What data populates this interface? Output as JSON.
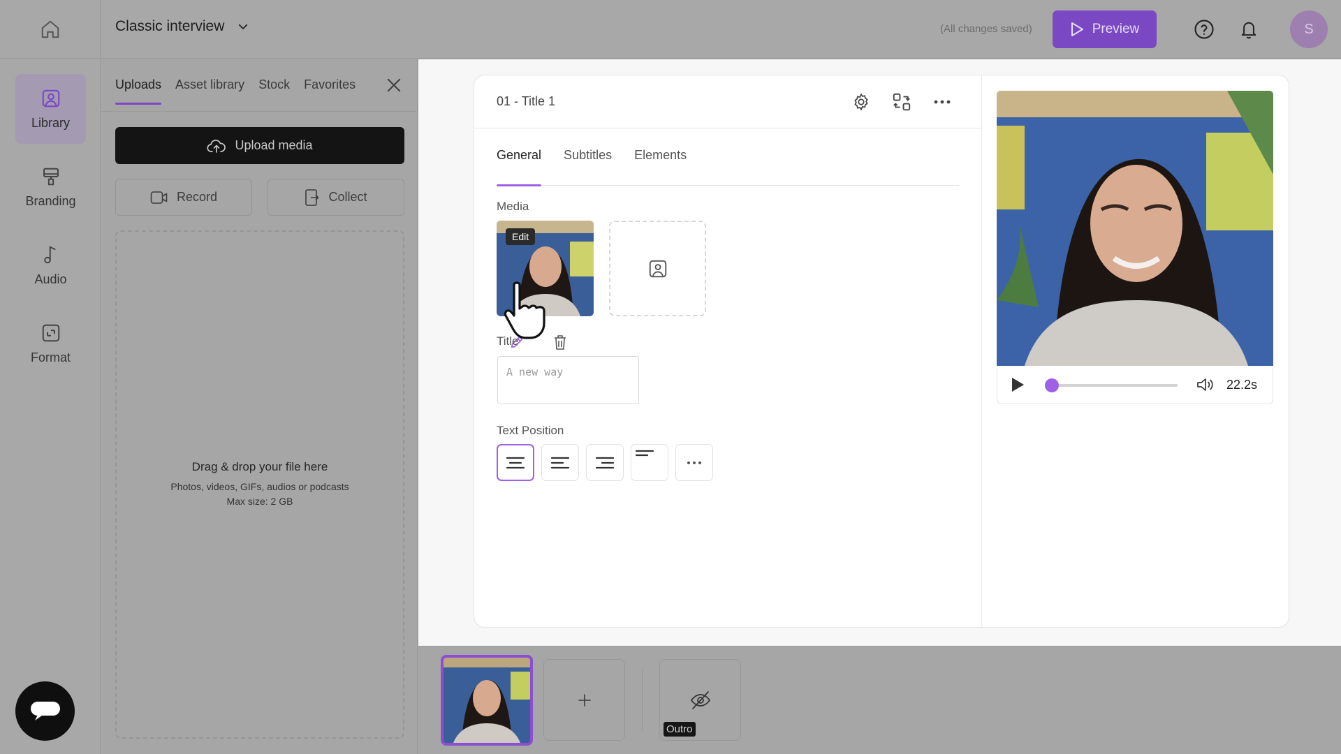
{
  "topbar": {
    "project_title": "Classic interview",
    "save_status": "(All changes saved)",
    "preview_label": "Preview",
    "avatar_initial": "S"
  },
  "nav": {
    "items": [
      {
        "label": "Library",
        "icon": "library-icon",
        "active": true
      },
      {
        "label": "Branding",
        "icon": "branding-icon"
      },
      {
        "label": "Audio",
        "icon": "music-note-icon"
      },
      {
        "label": "Format",
        "icon": "format-icon"
      }
    ]
  },
  "library": {
    "tabs": [
      {
        "label": "Uploads",
        "active": true
      },
      {
        "label": "Asset library"
      },
      {
        "label": "Stock"
      },
      {
        "label": "Favorites"
      }
    ],
    "upload_label": "Upload media",
    "record_label": "Record",
    "collect_label": "Collect",
    "dropzone": {
      "title": "Drag & drop your file here",
      "line1": "Photos, videos, GIFs, audios or podcasts",
      "line2": "Max size: 2 GB"
    }
  },
  "editor": {
    "scene_name": "01 - Title 1",
    "tabs": [
      {
        "label": "General",
        "active": true
      },
      {
        "label": "Subtitles"
      },
      {
        "label": "Elements"
      }
    ],
    "media_label": "Media",
    "edit_tooltip": "Edit",
    "title_label": "Title",
    "title_placeholder": "A new way",
    "text_position_label": "Text Position",
    "text_positions": [
      "align-center-icon",
      "align-left-icon",
      "align-right-icon",
      "align-top-left-icon",
      "more-options-icon"
    ]
  },
  "player": {
    "duration": "22.2s",
    "progress_fraction": 0.05
  },
  "timeline": {
    "outro_label": "Outro"
  },
  "colors": {
    "accent": "#9e60e6",
    "preview_button": "#7b48c4"
  }
}
